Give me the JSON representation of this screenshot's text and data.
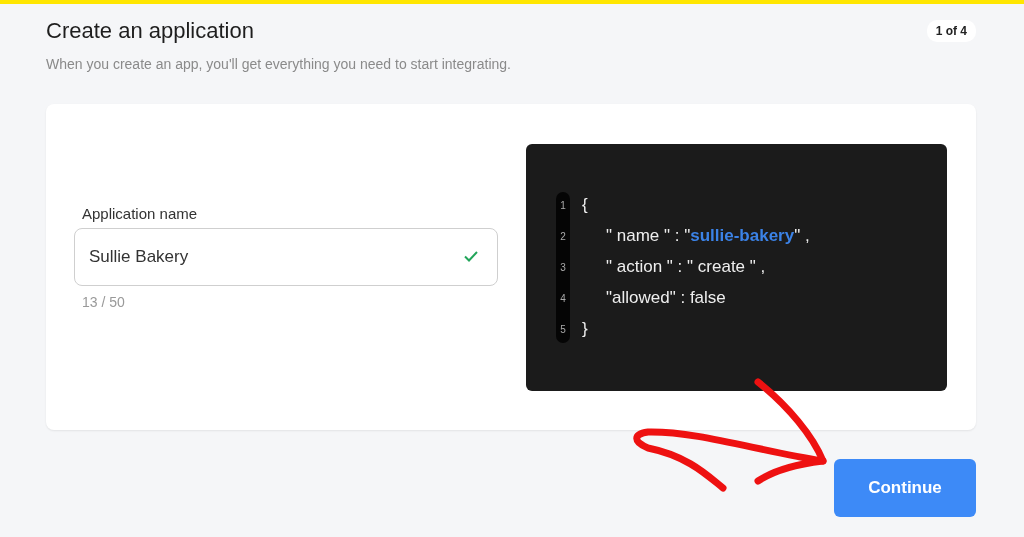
{
  "header": {
    "title": "Create an application",
    "step": "1 of 4",
    "subtitle": "When you create an app, you'll get everything you need to start integrating."
  },
  "form": {
    "label": "Application name",
    "value": "Sullie Bakery",
    "valid": true,
    "counter": "13 / 50"
  },
  "code": {
    "lines": [
      {
        "number": "1",
        "segments": [
          {
            "kind": "plain",
            "text": "{"
          }
        ],
        "children": [
          {
            "number": "2",
            "segments": [
              {
                "kind": "plain",
                "text": "\" name \" : \""
              },
              {
                "kind": "string",
                "text": "sullie-bakery"
              },
              {
                "kind": "plain",
                "text": "\" ,"
              }
            ]
          },
          {
            "number": "3",
            "segments": [
              {
                "kind": "plain",
                "text": "\" action \" : \" create \" ,"
              }
            ]
          },
          {
            "number": "4",
            "segments": [
              {
                "kind": "plain",
                "text": "\"allowed\" : false"
              }
            ]
          }
        ]
      },
      {
        "number": "5",
        "segments": [
          {
            "kind": "plain",
            "text": "}"
          }
        ]
      }
    ]
  },
  "buttons": [
    {
      "label": "Continue"
    }
  ]
}
